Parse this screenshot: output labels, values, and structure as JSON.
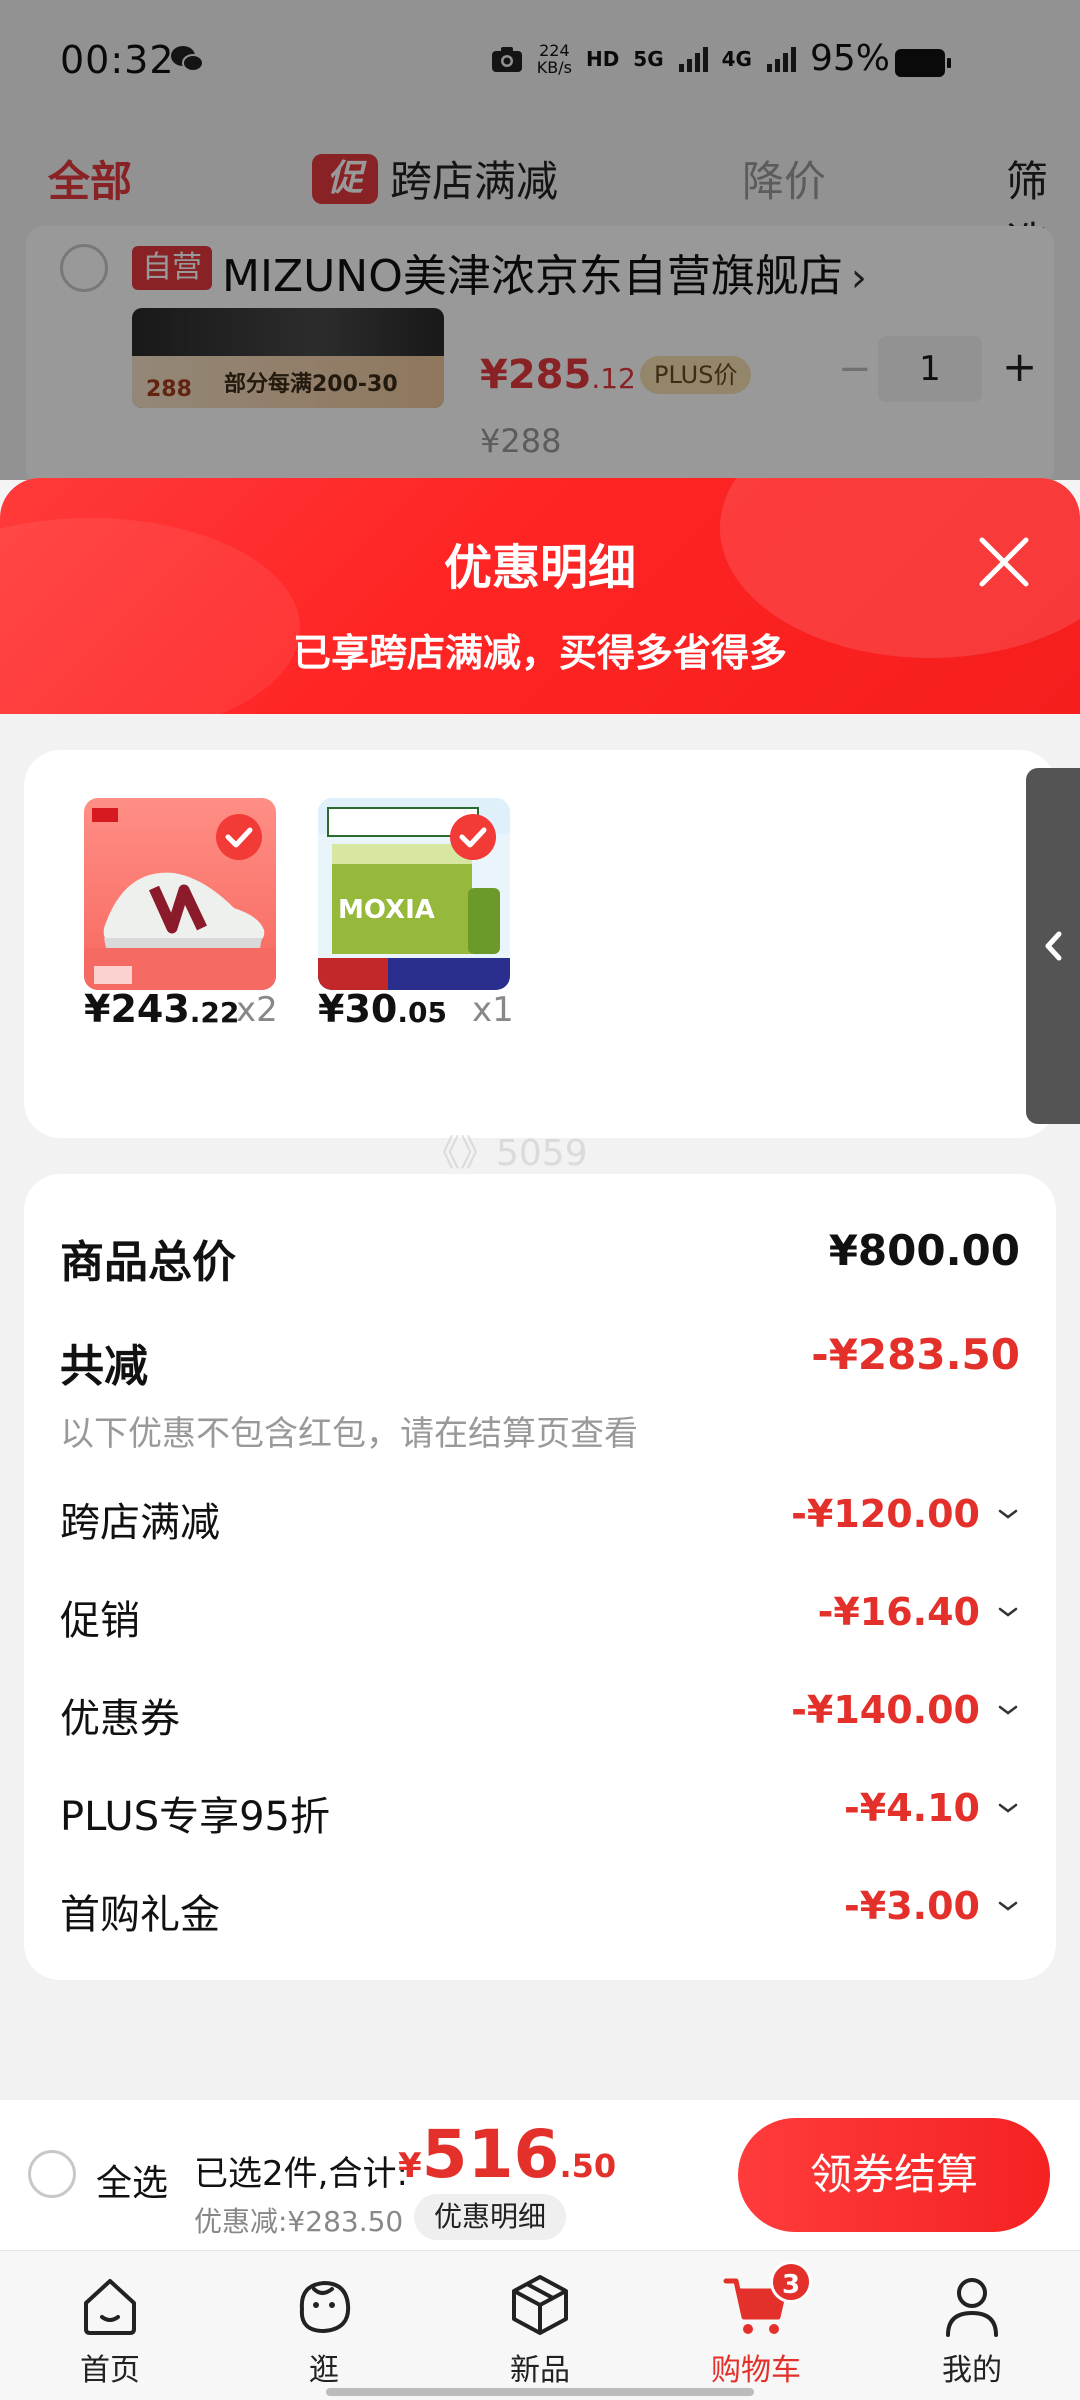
{
  "status_bar": {
    "time": "00:32",
    "speed": "224\nKB/s",
    "hd": "HD",
    "net_5g": "5G",
    "net_4g": "4G",
    "battery": "95%"
  },
  "cart_tabs": {
    "all": "全部",
    "promo_tag": "促",
    "cross_store": "跨店满减",
    "price_drop": "降价",
    "filter": "筛选"
  },
  "store": {
    "self_tag": "自营",
    "name": "MIZUNO美津浓京东自营旗舰店",
    "arrow": "›",
    "thumb_price": "288",
    "thumb_text": "部分每满200-30",
    "price_int": "¥285",
    "price_dec": ".12",
    "plus_tag": "PLUS价",
    "orig_price": "¥288",
    "qty": "1",
    "minus": "−",
    "plus": "+"
  },
  "sheet": {
    "title": "优惠明细",
    "subtitle": "已享跨店满减，买得多省得多",
    "goods": [
      {
        "price_int": "¥243",
        "price_dec": ".22",
        "qty": "x2"
      },
      {
        "price_int": "¥30",
        "price_dec": ".05",
        "qty": "x1"
      }
    ],
    "watermark": "《》5059",
    "summary": {
      "total_label": "商品总价",
      "total_value": "¥800.00",
      "reduce_label": "共减",
      "reduce_value": "-¥283.50",
      "note": "以下优惠不包含红包，请在结算页查看",
      "items": [
        {
          "label": "跨店满减",
          "value": "-¥120.00"
        },
        {
          "label": "促销",
          "value": "-¥16.40"
        },
        {
          "label": "优惠券",
          "value": "-¥140.00"
        },
        {
          "label": "PLUS专享95折",
          "value": "-¥4.10"
        },
        {
          "label": "首购礼金",
          "value": "-¥3.00"
        }
      ]
    }
  },
  "bottom_bar": {
    "select_all": "全选",
    "selected_text": "已选2件,合计:",
    "total_currency": "¥",
    "total_int": "516",
    "total_dec": ".50",
    "discount_text": "优惠减:¥283.50",
    "detail_button": "优惠明细",
    "checkout_button": "领券结算"
  },
  "tabbar": {
    "items": [
      {
        "label": "首页",
        "icon": "home-icon"
      },
      {
        "label": "逛",
        "icon": "explore-icon"
      },
      {
        "label": "新品",
        "icon": "new-products-icon"
      },
      {
        "label": "购物车",
        "icon": "cart-icon",
        "badge": "3"
      },
      {
        "label": "我的",
        "icon": "profile-icon"
      }
    ]
  },
  "colors": {
    "accent_red": "#e4302b",
    "sheet_red": "#ff2a2a",
    "dark_handle": "#545454"
  }
}
